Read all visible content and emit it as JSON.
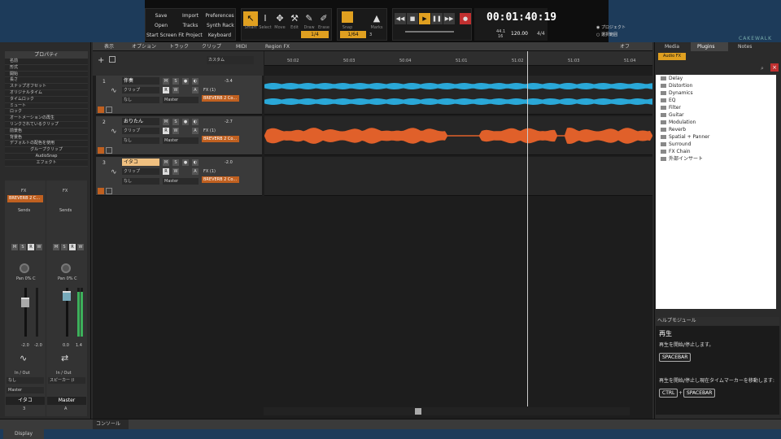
{
  "toolbar": {
    "file_buttons": [
      "Save",
      "Open",
      "Start Screen",
      "Import",
      "Fit Project",
      "Tracks",
      "Keyboard",
      "Preferences",
      "Synth Rack"
    ],
    "tools": [
      "Smart",
      "Select",
      "Move",
      "Edit",
      "Draw",
      "Erase"
    ],
    "snap_label": "Snap",
    "snap_value": "1/4",
    "marks_label": "Marks",
    "grid_value": "1/64",
    "grid_count": "3",
    "time": "00:01:40:19",
    "sample_rate": "44.1",
    "bit_depth": "16",
    "tempo": "120.00",
    "meter": "4/4",
    "radio_project": "プロジェクト",
    "radio_selection": "選択範囲",
    "brand": "CAKEWALK"
  },
  "left_panel": {
    "props_title": "プロパティ",
    "props": [
      "名前",
      "形式",
      "開始",
      "長さ",
      "スナップオフセット",
      "オリジナルタイム",
      "タイムロック",
      "ミュート",
      "ロック",
      "オートメーションの再生",
      "リンクされているクリップ",
      "前景色",
      "背景色",
      "デフォルトの配色を使用"
    ],
    "section_group": "グループクリップ",
    "section_audiosnap": "AudioSnap",
    "section_effect": "エフェクト",
    "fx_label": "FX",
    "fx_slot": "BREVERB 2 C...",
    "sends_label": "Sends",
    "pan_label": "Pan",
    "pan_value": "0% C",
    "strip1": {
      "val_l": "-2.0",
      "val_r": "-2.0",
      "in_out": "In / Out",
      "input": "なし",
      "output": "Master",
      "name": "イタコ",
      "num": "3"
    },
    "strip2": {
      "val_l": "0.0",
      "val_r": "1.4",
      "in_out": "In / Out",
      "input": "スピーカー (I",
      "output": "",
      "name": "Master",
      "num": "A"
    },
    "display_label": "Display"
  },
  "track_menu": [
    "表示",
    "オプション",
    "トラック",
    "クリップ",
    "MIDI",
    "Region FX"
  ],
  "track_menu_right": "オフ",
  "view_preset": "カスタム",
  "ruler_ticks": [
    "50:02",
    "50:03",
    "50:04",
    "51:01",
    "51:02",
    "51:03",
    "51:04"
  ],
  "tracks": [
    {
      "num": "1",
      "name": "伴奏",
      "clip": "クリップ",
      "input": "なし",
      "output": "Master",
      "vol": "-3.4",
      "fx": "FX (1)",
      "fx_slot": "BREVERB 2 Co...",
      "color": "#2aa8d8"
    },
    {
      "num": "2",
      "name": "おりたん",
      "clip": "クリップ",
      "input": "なし",
      "output": "Master",
      "vol": "-2.7",
      "fx": "FX (1)",
      "fx_slot": "BREVERB 2 Co...",
      "color": "#e0602a"
    },
    {
      "num": "3",
      "name": "イタコ",
      "clip": "クリップ",
      "input": "なし",
      "output": "Master",
      "vol": "-2.0",
      "fx": "FX (1)",
      "fx_slot": "BREVERB 2 Co...",
      "color": "#888"
    }
  ],
  "right_panel": {
    "tabs": [
      "Media",
      "Plugins",
      "Notes"
    ],
    "category": "Audio FX",
    "plugins": [
      "Delay",
      "Distortion",
      "Dynamics",
      "EQ",
      "Filter",
      "Guitar",
      "Modulation",
      "Reverb",
      "Spatial + Panner",
      "Surround",
      "FX Chain",
      "外部インサート"
    ],
    "help_title": "ヘルプモジュール",
    "help_heading": "再生",
    "help_text1": "再生を開始/停止します。",
    "help_key1": "SPACEBAR",
    "help_text2": "再生を開始/停止し現在タイムマーカーを移動します:",
    "help_key2a": "CTRL",
    "help_plus": "+",
    "help_key2b": "SPACEBAR"
  },
  "bottom": {
    "console_label": "コンソール"
  }
}
